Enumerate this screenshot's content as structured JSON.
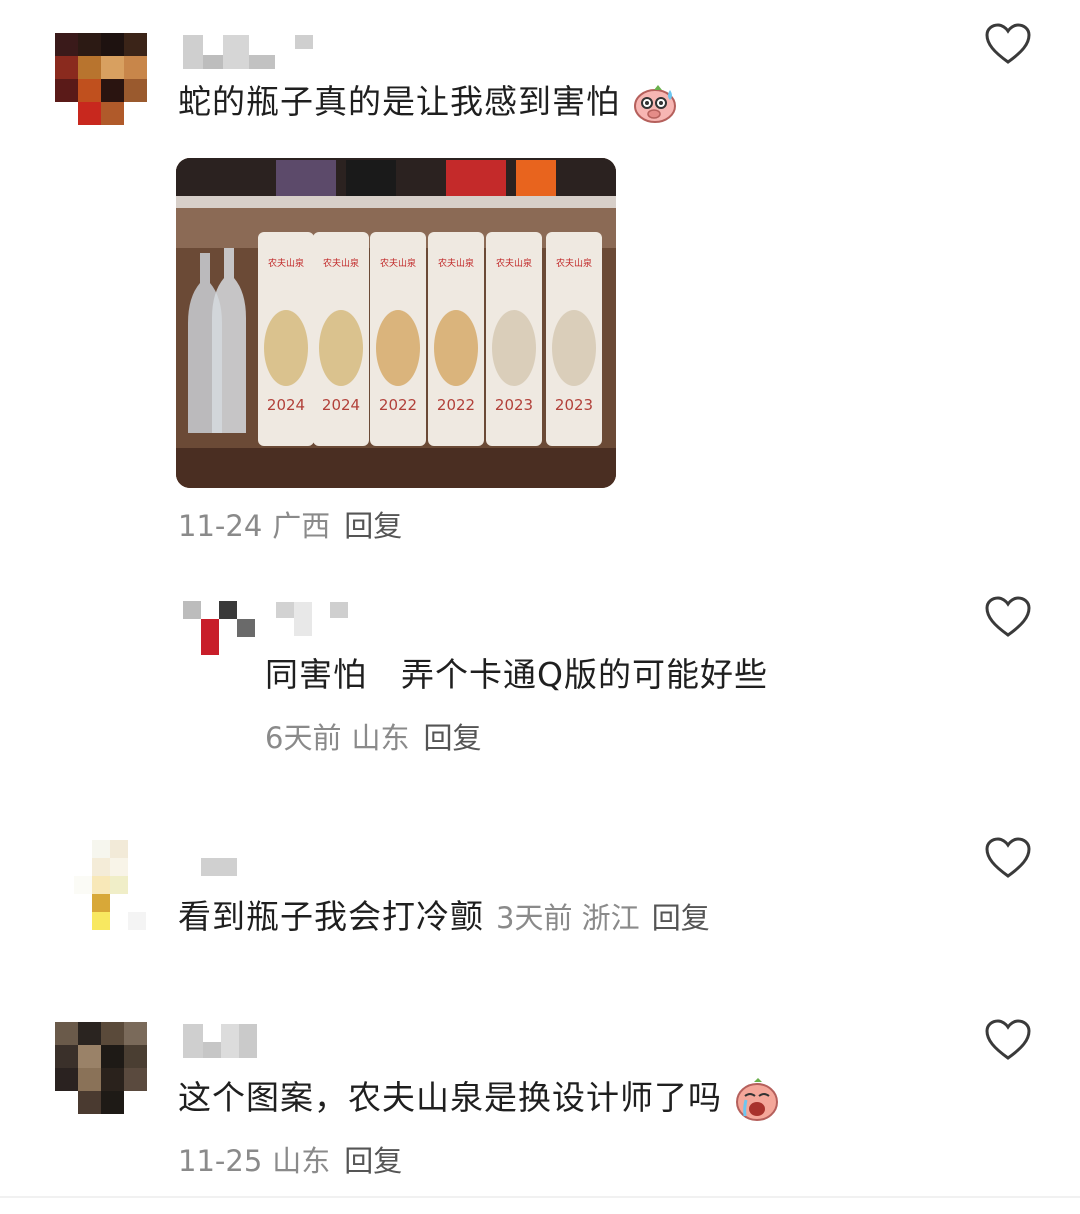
{
  "comments": [
    {
      "text": "蛇的瓶子真的是让我感到害怕",
      "emoji": "sweating-pig-emoji",
      "has_image": true,
      "image_labels": {
        "brand": [
          "农夫山泉",
          "农夫山泉",
          "农夫山泉",
          "农夫山泉",
          "农夫山泉",
          "农夫山泉"
        ],
        "years": [
          "2024",
          "2024",
          "2022",
          "2022",
          "2023",
          "2023"
        ]
      },
      "date": "11-24",
      "location": "广西",
      "reply_label": "回复",
      "like_icon": "heart-outline-icon"
    },
    {
      "is_reply": true,
      "text": "同害怕　弄个卡通Q版的可能好些",
      "date": "6天前",
      "location": "山东",
      "reply_label": "回复",
      "like_icon": "heart-outline-icon"
    },
    {
      "text": "看到瓶子我会打冷颤",
      "date": "3天前",
      "location": "浙江",
      "reply_label": "回复",
      "like_icon": "heart-outline-icon"
    },
    {
      "text": "这个图案，农夫山泉是换设计师了吗",
      "emoji": "crying-face-emoji",
      "date": "11-25",
      "location": "山东",
      "reply_label": "回复",
      "like_icon": "heart-outline-icon"
    }
  ],
  "colors": {
    "text": "#1f1f1f",
    "meta": "#8a8a8a",
    "icon": "#3a3a3a"
  }
}
